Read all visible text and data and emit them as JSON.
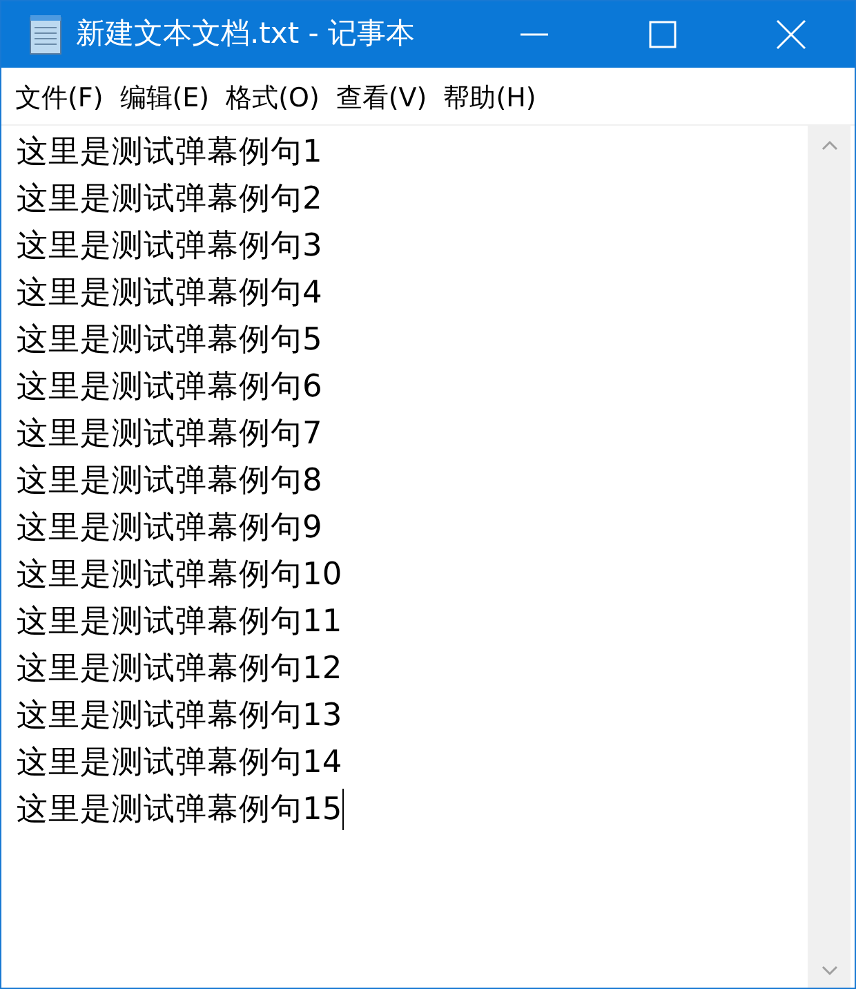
{
  "window": {
    "title": "新建文本文档.txt - 记事本"
  },
  "menu": [
    "文件(F)",
    "编辑(E)",
    "格式(O)",
    "查看(V)",
    "帮助(H)"
  ],
  "lines": [
    "这里是测试弹幕例句1",
    "这里是测试弹幕例句2",
    "这里是测试弹幕例句3",
    "这里是测试弹幕例句4",
    "这里是测试弹幕例句5",
    "这里是测试弹幕例句6",
    "这里是测试弹幕例句7",
    "这里是测试弹幕例句8",
    "这里是测试弹幕例句9",
    "这里是测试弹幕例句10",
    "这里是测试弹幕例句11",
    "这里是测试弹幕例句12",
    "这里是测试弹幕例句13",
    "这里是测试弹幕例句14",
    "这里是测试弹幕例句15"
  ]
}
